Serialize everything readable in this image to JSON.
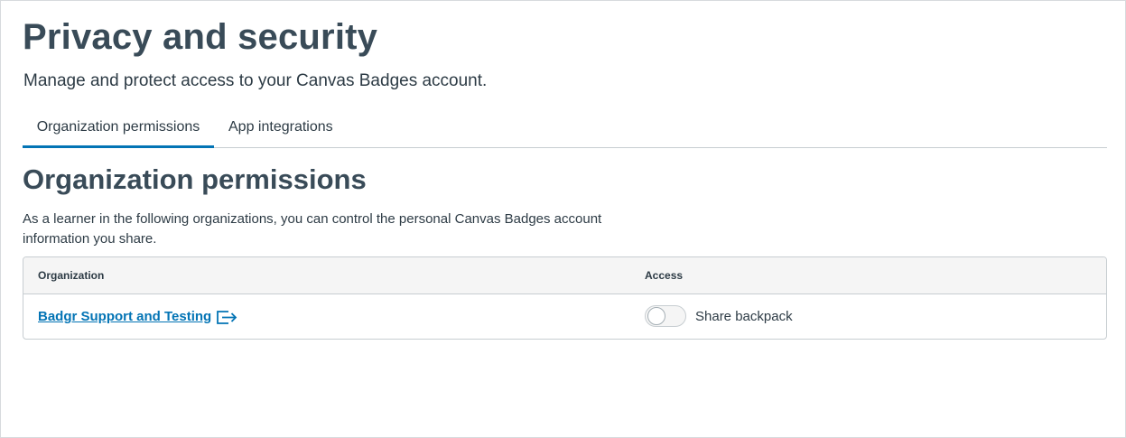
{
  "header": {
    "title": "Privacy and security",
    "subtitle": "Manage and protect access to your Canvas Badges account."
  },
  "tabs": [
    {
      "label": "Organization permissions",
      "active": true
    },
    {
      "label": "App integrations",
      "active": false
    }
  ],
  "section": {
    "title": "Organization permissions",
    "description": "As a learner in the following organizations, you can control the personal Canvas Badges account information you share."
  },
  "table": {
    "columns": [
      "Organization",
      "Access"
    ],
    "rows": [
      {
        "organization": "Badgr Support and Testing",
        "org_icon": "external-link-icon",
        "access_label": "Share backpack",
        "access_enabled": false
      }
    ]
  },
  "colors": {
    "accent": "#0374b5",
    "heading": "#394b58",
    "text": "#2d3b45"
  }
}
